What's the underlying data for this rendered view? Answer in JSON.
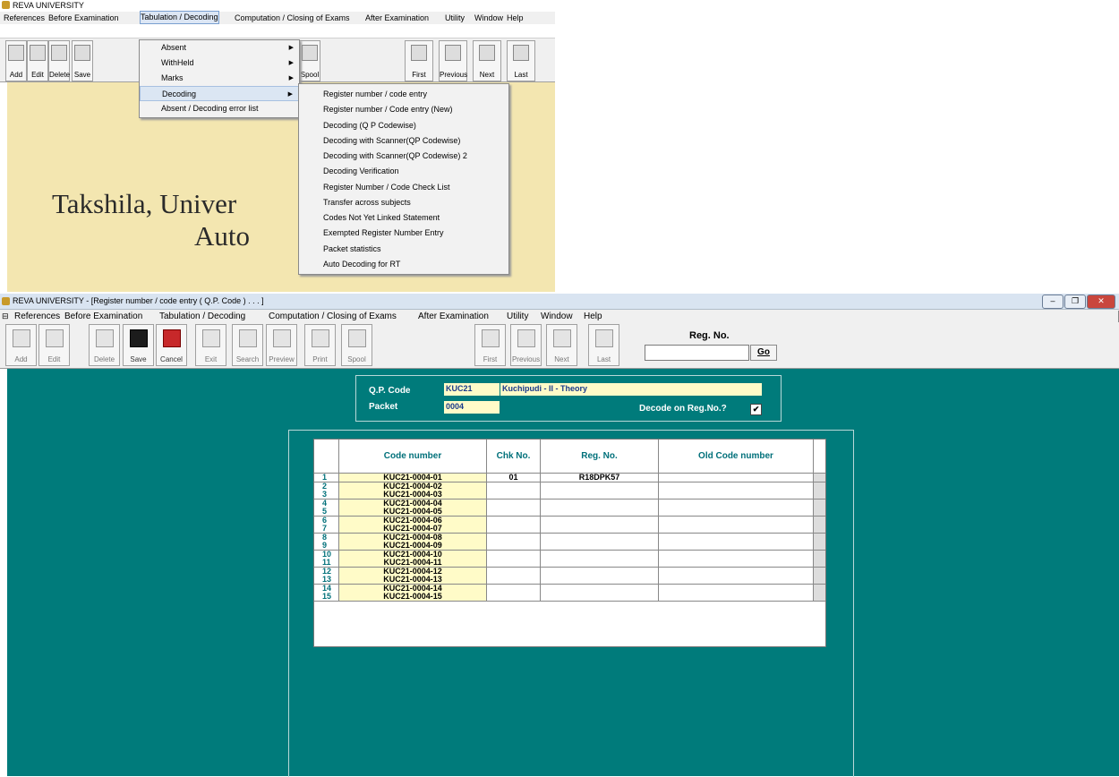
{
  "top": {
    "title": "REVA UNIVERSITY",
    "menu": [
      "References",
      "Before Examination",
      "Tabulation / Decoding",
      "Computation / Closing of Exams",
      "After Examination",
      "Utility",
      "Window",
      "Help"
    ],
    "toolbar": [
      "Add",
      "Edit",
      "Delete",
      "Save",
      "Spool",
      "First",
      "Previous",
      "Next",
      "Last"
    ],
    "dropdown": [
      "Absent",
      "WithHeld",
      "Marks",
      "Decoding",
      "Absent / Decoding error list"
    ],
    "submenu": [
      "Register number / code entry",
      "Register number / Code entry (New)",
      "Decoding (Q P Codewise)",
      "Decoding with Scanner(QP Codewise)",
      "Decoding with Scanner(QP Codewise) 2",
      "Decoding Verification",
      "Register Number / Code Check List",
      "Transfer across subjects",
      "Codes Not Yet Linked Statement",
      "Exempted Register Number Entry",
      "Packet statistics",
      "Auto Decoding for RT"
    ],
    "splash_line1": "Takshila, Univer",
    "splash_line2": "Auto"
  },
  "win": {
    "title": "REVA UNIVERSITY - [Register number / code entry ( Q.P. Code ) . . . ]",
    "menu": [
      "References",
      "Before Examination",
      "Tabulation / Decoding",
      "Computation / Closing of Exams",
      "After Examination",
      "Utility",
      "Window",
      "Help"
    ],
    "toolbar": [
      "Add",
      "Edit",
      "Delete",
      "Save",
      "Cancel",
      "Exit",
      "Search",
      "Preview",
      "Print",
      "Spool",
      "First",
      "Previous",
      "Next",
      "Last"
    ],
    "regno_label": "Reg. No.",
    "go_label": "Go",
    "window_buttons": [
      "–",
      "❐",
      "✕"
    ]
  },
  "form": {
    "qp_code_label": "Q.P. Code",
    "qp_code": "KUC21",
    "qp_name": "Kuchipudi - II - Theory",
    "packet_label": "Packet",
    "packet": "0004",
    "decode_label": "Decode on Reg.No.?",
    "decode_checked": "✔"
  },
  "grid": {
    "headers": [
      "Code number",
      "Chk No.",
      "Reg. No.",
      "Old Code number"
    ],
    "rows": [
      {
        "n": "1",
        "code": "KUC21-0004-01",
        "chk": "01",
        "reg": "R18DPK57",
        "old": ""
      },
      {
        "n": "2",
        "code": "KUC21-0004-02",
        "chk": "",
        "reg": "",
        "old": ""
      },
      {
        "n": "3",
        "code": "KUC21-0004-03",
        "chk": "",
        "reg": "",
        "old": ""
      },
      {
        "n": "4",
        "code": "KUC21-0004-04",
        "chk": "",
        "reg": "",
        "old": ""
      },
      {
        "n": "5",
        "code": "KUC21-0004-05",
        "chk": "",
        "reg": "",
        "old": ""
      },
      {
        "n": "6",
        "code": "KUC21-0004-06",
        "chk": "",
        "reg": "",
        "old": ""
      },
      {
        "n": "7",
        "code": "KUC21-0004-07",
        "chk": "",
        "reg": "",
        "old": ""
      },
      {
        "n": "8",
        "code": "KUC21-0004-08",
        "chk": "",
        "reg": "",
        "old": ""
      },
      {
        "n": "9",
        "code": "KUC21-0004-09",
        "chk": "",
        "reg": "",
        "old": ""
      },
      {
        "n": "10",
        "code": "KUC21-0004-10",
        "chk": "",
        "reg": "",
        "old": ""
      },
      {
        "n": "11",
        "code": "KUC21-0004-11",
        "chk": "",
        "reg": "",
        "old": ""
      },
      {
        "n": "12",
        "code": "KUC21-0004-12",
        "chk": "",
        "reg": "",
        "old": ""
      },
      {
        "n": "13",
        "code": "KUC21-0004-13",
        "chk": "",
        "reg": "",
        "old": ""
      },
      {
        "n": "14",
        "code": "KUC21-0004-14",
        "chk": "",
        "reg": "",
        "old": ""
      },
      {
        "n": "15",
        "code": "KUC21-0004-15",
        "chk": "",
        "reg": "",
        "old": ""
      }
    ]
  }
}
